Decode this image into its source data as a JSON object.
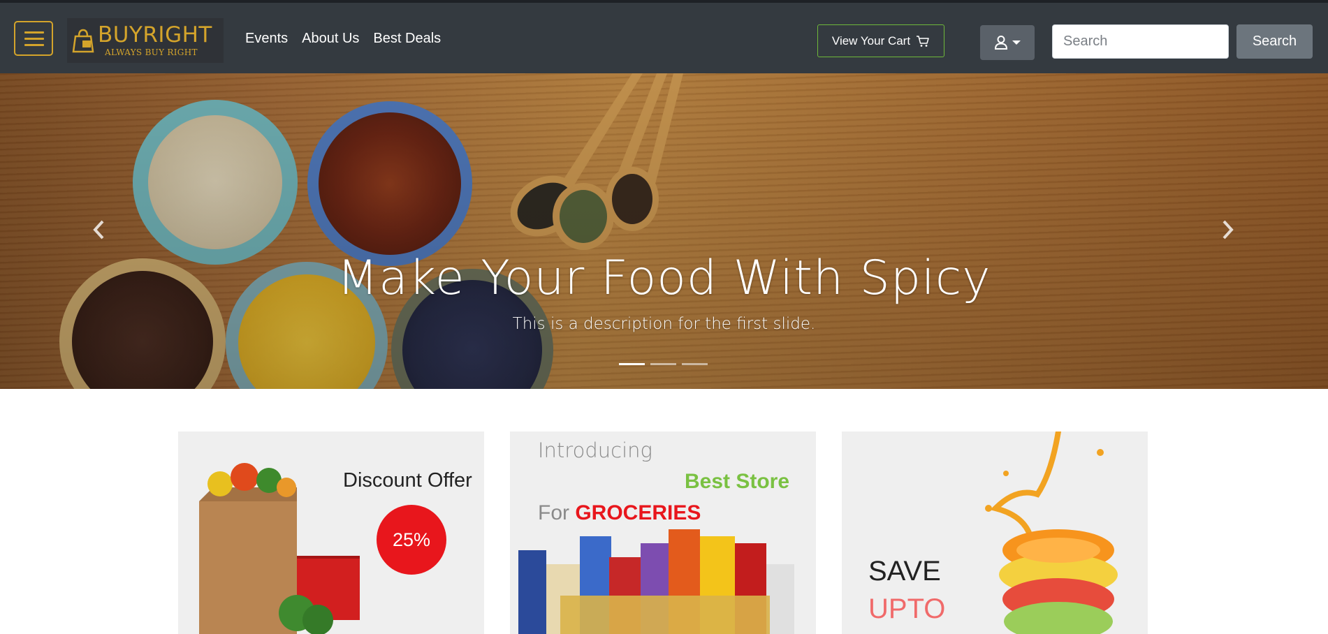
{
  "navbar": {
    "brand": "BUYRIGHT",
    "tagline": "ALWAYS BUY RIGHT",
    "links": [
      "Events",
      "About Us",
      "Best Deals"
    ],
    "cart_label": "View Your Cart",
    "search_placeholder": "Search",
    "search_button": "Search"
  },
  "carousel": {
    "title": "Make Your Food With Spicy",
    "description": "This is a description for the first slide.",
    "active_slide": 1,
    "slide_count": 3
  },
  "cards": {
    "discount": {
      "title": "Discount Offer",
      "badge": "25%"
    },
    "store": {
      "intro": "Introducing",
      "highlight": "Best Store",
      "for": "For",
      "category": "GROCERIES"
    },
    "juice": {
      "line1": "SAVE",
      "line2": "UPTO"
    }
  },
  "colors": {
    "navbar_bg": "#343a40",
    "brand_gold": "#d4a42b",
    "cart_border": "#6fb83a",
    "badge_red": "#e8161c",
    "best_store_green": "#7ac142"
  }
}
